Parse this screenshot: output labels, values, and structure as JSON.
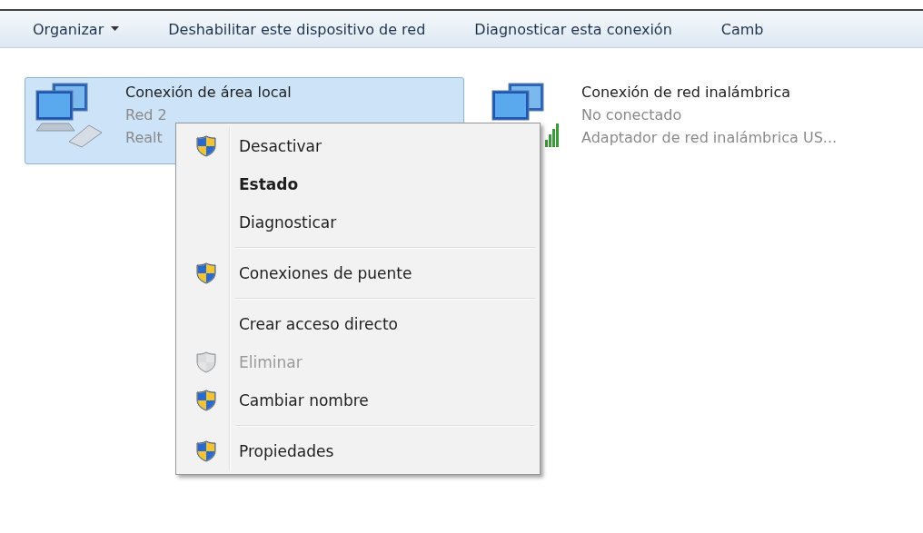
{
  "toolbar": {
    "items": [
      {
        "label": "Organizar",
        "dropdown": true
      },
      {
        "label": "Deshabilitar este dispositivo de red",
        "dropdown": false
      },
      {
        "label": "Diagnosticar esta conexión",
        "dropdown": false
      },
      {
        "label": "Camb",
        "dropdown": false
      }
    ]
  },
  "connections": [
    {
      "kind": "wired",
      "name": "Conexión de área local",
      "status": "Red 2",
      "adapter": "Realt",
      "selected": true
    },
    {
      "kind": "wireless",
      "name": "Conexión de red inalámbrica",
      "status": "No conectado",
      "adapter": "Adaptador de red inalámbrica US...",
      "selected": false
    }
  ],
  "context_menu": {
    "groups": [
      [
        {
          "label": "Desactivar",
          "shield": true,
          "default": false,
          "disabled": false
        },
        {
          "label": "Estado",
          "shield": false,
          "default": true,
          "disabled": false
        },
        {
          "label": "Diagnosticar",
          "shield": false,
          "default": false,
          "disabled": false
        }
      ],
      [
        {
          "label": "Conexiones de puente",
          "shield": true,
          "default": false,
          "disabled": false
        }
      ],
      [
        {
          "label": "Crear acceso directo",
          "shield": false,
          "default": false,
          "disabled": false
        },
        {
          "label": "Eliminar",
          "shield": true,
          "default": false,
          "disabled": true
        },
        {
          "label": "Cambiar nombre",
          "shield": true,
          "default": false,
          "disabled": false
        }
      ],
      [
        {
          "label": "Propiedades",
          "shield": true,
          "default": false,
          "disabled": false
        }
      ]
    ]
  }
}
